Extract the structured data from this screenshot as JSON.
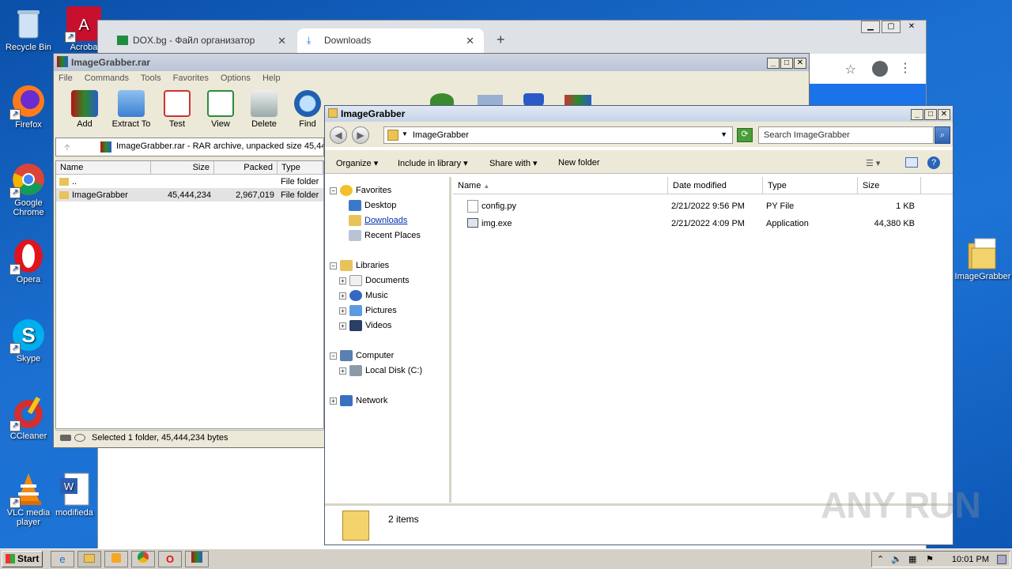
{
  "desktop": {
    "icons": [
      {
        "label": "Recycle Bin",
        "icon": "recycle-bin-icon"
      },
      {
        "label": "Acroba",
        "icon": "acrobat-icon"
      },
      {
        "label": "Firefox",
        "icon": "firefox-icon"
      },
      {
        "label": "Google Chrome",
        "icon": "chrome-icon"
      },
      {
        "label": "Opera",
        "icon": "opera-icon"
      },
      {
        "label": "Skype",
        "icon": "skype-icon"
      },
      {
        "label": "CCleaner",
        "icon": "ccleaner-icon"
      },
      {
        "label": "VLC media player",
        "icon": "vlc-icon"
      },
      {
        "label": "modifieda",
        "icon": "word-doc-icon"
      },
      {
        "label": "ImageGrabber",
        "icon": "folder-icon"
      }
    ]
  },
  "chrome": {
    "tabs": [
      {
        "label": "DOX.bg - Файл организатор",
        "active": false
      },
      {
        "label": "Downloads",
        "active": true
      }
    ],
    "new_tab": "+",
    "close": "✕"
  },
  "winrar": {
    "title": "ImageGrabber.rar",
    "menu": [
      "File",
      "Commands",
      "Tools",
      "Favorites",
      "Options",
      "Help"
    ],
    "tools": [
      "Add",
      "Extract To",
      "Test",
      "View",
      "Delete",
      "Find"
    ],
    "address": "ImageGrabber.rar - RAR archive, unpacked size 45,44",
    "columns": [
      "Name",
      "Size",
      "Packed",
      "Type"
    ],
    "rows": [
      {
        "name": "..",
        "size": "",
        "packed": "",
        "type": "File folder"
      },
      {
        "name": "ImageGrabber",
        "size": "45,444,234",
        "packed": "2,967,019",
        "type": "File folder"
      }
    ],
    "status": "Selected 1 folder, 45,444,234 bytes"
  },
  "explorer": {
    "title": "ImageGrabber",
    "path": "ImageGrabber",
    "search_placeholder": "Search ImageGrabber",
    "commands": {
      "organize": "Organize",
      "include": "Include in library",
      "share": "Share with",
      "new_folder": "New folder"
    },
    "nav": {
      "favorites": "Favorites",
      "desktop": "Desktop",
      "downloads": "Downloads",
      "recent": "Recent Places",
      "libraries": "Libraries",
      "documents": "Documents",
      "music": "Music",
      "pictures": "Pictures",
      "videos": "Videos",
      "computer": "Computer",
      "local_disk": "Local Disk (C:)",
      "network": "Network"
    },
    "columns": {
      "name": "Name",
      "date": "Date modified",
      "type": "Type",
      "size": "Size"
    },
    "files": [
      {
        "name": "config.py",
        "date": "2/21/2022 9:56 PM",
        "type": "PY File",
        "size": "1 KB"
      },
      {
        "name": "img.exe",
        "date": "2/21/2022 4:09 PM",
        "type": "Application",
        "size": "44,380 KB"
      }
    ],
    "item_count": "2 items"
  },
  "taskbar": {
    "start": "Start",
    "clock": "10:01 PM"
  },
  "watermark": "ANY RUN"
}
